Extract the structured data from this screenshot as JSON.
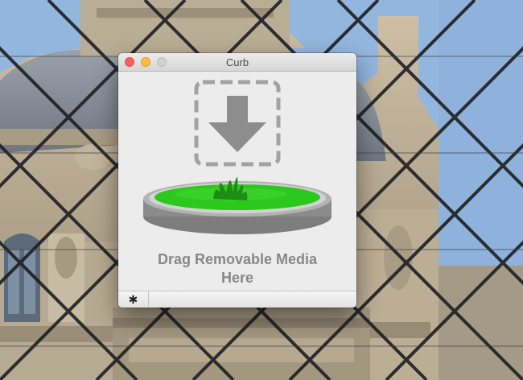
{
  "window": {
    "title": "Curb",
    "traffic_lights": {
      "close_color": "#fc605c",
      "minimize_color": "#fdbc40",
      "zoom_color": "#d0d0d0"
    }
  },
  "drop_zone": {
    "line1": "Drag Removable Media",
    "line2": "Here",
    "accent_color": "#2cc81e",
    "icons": [
      "download-arrow-icon",
      "grass-platform-icon"
    ]
  },
  "bottom_bar": {
    "settings_icon": "gear-icon",
    "settings_glyph": "✱"
  }
}
